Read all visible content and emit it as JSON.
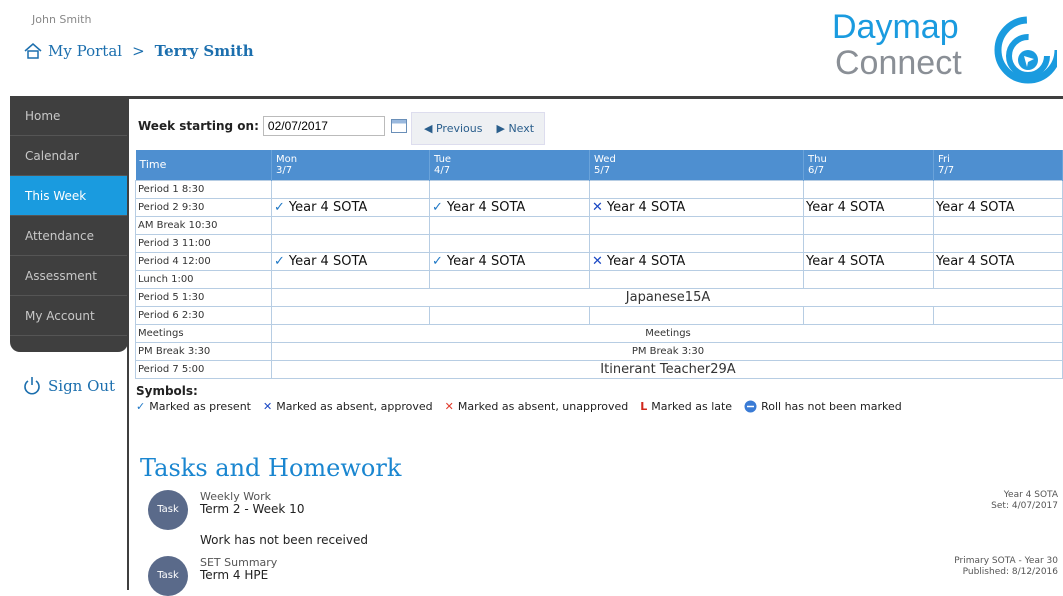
{
  "user": "John Smith",
  "breadcrumb": {
    "home": "My Portal",
    "sep": ">",
    "current": "Terry Smith"
  },
  "logo": {
    "line1": "Daymap",
    "line2": "Connect",
    "color": "#1a9bdf"
  },
  "nav": [
    {
      "label": "Home"
    },
    {
      "label": "Calendar"
    },
    {
      "label": "This Week"
    },
    {
      "label": "Attendance"
    },
    {
      "label": "Assessment"
    },
    {
      "label": "My Account"
    }
  ],
  "signout": "Sign Out",
  "week": {
    "label": "Week starting on:",
    "value": "02/07/2017",
    "prev": "Previous",
    "next": "Next"
  },
  "timetable": {
    "time_header": "Time",
    "days": [
      {
        "day": "Mon",
        "date": "3/7"
      },
      {
        "day": "Tue",
        "date": "4/7"
      },
      {
        "day": "Wed",
        "date": "5/7"
      },
      {
        "day": "Thu",
        "date": "6/7"
      },
      {
        "day": "Fri",
        "date": "7/7"
      }
    ],
    "rows": [
      {
        "time": "Period 1 8:30"
      },
      {
        "time": "Period 2 9:30",
        "cells": [
          "Year 4 SOTA",
          "Year 4 SOTA",
          "Year 4 SOTA",
          "Year 4 SOTA",
          "Year 4 SOTA"
        ]
      },
      {
        "time": "AM Break 10:30"
      },
      {
        "time": "Period 3 11:00"
      },
      {
        "time": "Period 4 12:00",
        "cells": [
          "Year 4 SOTA",
          "Year 4 SOTA",
          "Year 4 SOTA",
          "Year 4 SOTA",
          "Year 4 SOTA"
        ]
      },
      {
        "time": "Lunch 1:00"
      },
      {
        "time": "Period 5 1:30",
        "span": "Japanese15A"
      },
      {
        "time": "Period 6 2:30"
      },
      {
        "time": "Meetings",
        "span": "Meetings"
      },
      {
        "time": "PM Break 3:30",
        "span": "PM Break 3:30"
      },
      {
        "time": "Period 7 5:00",
        "span": "Itinerant Teacher29A"
      }
    ]
  },
  "symbols": {
    "title": "Symbols:",
    "present": "Marked as present",
    "absent_approved": "Marked as absent, approved",
    "absent_unapproved": "Marked as absent, unapproved",
    "late": "Marked as late",
    "not_marked": "Roll has not been marked"
  },
  "tasks": {
    "heading": "Tasks and Homework",
    "items": [
      {
        "badge": "Task",
        "type": "Weekly Work",
        "title": "Term 2 - Week 10",
        "class": "Year 4 SOTA",
        "date": "Set: 4/07/2017",
        "note": "Work has not been received"
      },
      {
        "badge": "Task",
        "type": "SET Summary",
        "title": "Term 4 HPE",
        "class": "Primary SOTA - Year 30",
        "date": "Published: 8/12/2016"
      }
    ]
  }
}
